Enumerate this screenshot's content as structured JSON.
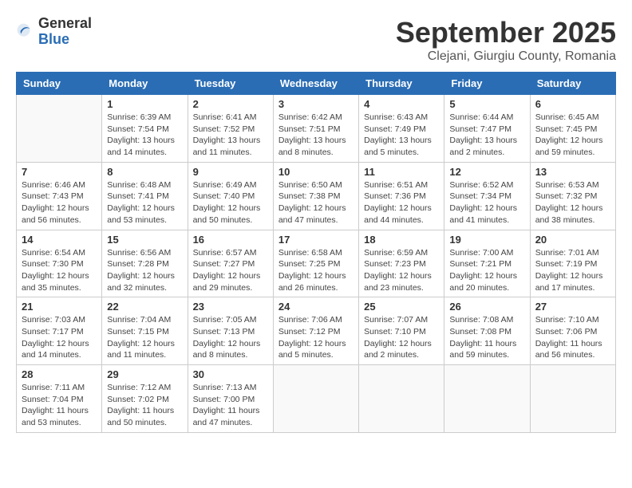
{
  "logo": {
    "general": "General",
    "blue": "Blue"
  },
  "title": "September 2025",
  "subtitle": "Clejani, Giurgiu County, Romania",
  "days_of_week": [
    "Sunday",
    "Monday",
    "Tuesday",
    "Wednesday",
    "Thursday",
    "Friday",
    "Saturday"
  ],
  "weeks": [
    [
      {
        "day": "",
        "info": ""
      },
      {
        "day": "1",
        "info": "Sunrise: 6:39 AM\nSunset: 7:54 PM\nDaylight: 13 hours\nand 14 minutes."
      },
      {
        "day": "2",
        "info": "Sunrise: 6:41 AM\nSunset: 7:52 PM\nDaylight: 13 hours\nand 11 minutes."
      },
      {
        "day": "3",
        "info": "Sunrise: 6:42 AM\nSunset: 7:51 PM\nDaylight: 13 hours\nand 8 minutes."
      },
      {
        "day": "4",
        "info": "Sunrise: 6:43 AM\nSunset: 7:49 PM\nDaylight: 13 hours\nand 5 minutes."
      },
      {
        "day": "5",
        "info": "Sunrise: 6:44 AM\nSunset: 7:47 PM\nDaylight: 13 hours\nand 2 minutes."
      },
      {
        "day": "6",
        "info": "Sunrise: 6:45 AM\nSunset: 7:45 PM\nDaylight: 12 hours\nand 59 minutes."
      }
    ],
    [
      {
        "day": "7",
        "info": "Sunrise: 6:46 AM\nSunset: 7:43 PM\nDaylight: 12 hours\nand 56 minutes."
      },
      {
        "day": "8",
        "info": "Sunrise: 6:48 AM\nSunset: 7:41 PM\nDaylight: 12 hours\nand 53 minutes."
      },
      {
        "day": "9",
        "info": "Sunrise: 6:49 AM\nSunset: 7:40 PM\nDaylight: 12 hours\nand 50 minutes."
      },
      {
        "day": "10",
        "info": "Sunrise: 6:50 AM\nSunset: 7:38 PM\nDaylight: 12 hours\nand 47 minutes."
      },
      {
        "day": "11",
        "info": "Sunrise: 6:51 AM\nSunset: 7:36 PM\nDaylight: 12 hours\nand 44 minutes."
      },
      {
        "day": "12",
        "info": "Sunrise: 6:52 AM\nSunset: 7:34 PM\nDaylight: 12 hours\nand 41 minutes."
      },
      {
        "day": "13",
        "info": "Sunrise: 6:53 AM\nSunset: 7:32 PM\nDaylight: 12 hours\nand 38 minutes."
      }
    ],
    [
      {
        "day": "14",
        "info": "Sunrise: 6:54 AM\nSunset: 7:30 PM\nDaylight: 12 hours\nand 35 minutes."
      },
      {
        "day": "15",
        "info": "Sunrise: 6:56 AM\nSunset: 7:28 PM\nDaylight: 12 hours\nand 32 minutes."
      },
      {
        "day": "16",
        "info": "Sunrise: 6:57 AM\nSunset: 7:27 PM\nDaylight: 12 hours\nand 29 minutes."
      },
      {
        "day": "17",
        "info": "Sunrise: 6:58 AM\nSunset: 7:25 PM\nDaylight: 12 hours\nand 26 minutes."
      },
      {
        "day": "18",
        "info": "Sunrise: 6:59 AM\nSunset: 7:23 PM\nDaylight: 12 hours\nand 23 minutes."
      },
      {
        "day": "19",
        "info": "Sunrise: 7:00 AM\nSunset: 7:21 PM\nDaylight: 12 hours\nand 20 minutes."
      },
      {
        "day": "20",
        "info": "Sunrise: 7:01 AM\nSunset: 7:19 PM\nDaylight: 12 hours\nand 17 minutes."
      }
    ],
    [
      {
        "day": "21",
        "info": "Sunrise: 7:03 AM\nSunset: 7:17 PM\nDaylight: 12 hours\nand 14 minutes."
      },
      {
        "day": "22",
        "info": "Sunrise: 7:04 AM\nSunset: 7:15 PM\nDaylight: 12 hours\nand 11 minutes."
      },
      {
        "day": "23",
        "info": "Sunrise: 7:05 AM\nSunset: 7:13 PM\nDaylight: 12 hours\nand 8 minutes."
      },
      {
        "day": "24",
        "info": "Sunrise: 7:06 AM\nSunset: 7:12 PM\nDaylight: 12 hours\nand 5 minutes."
      },
      {
        "day": "25",
        "info": "Sunrise: 7:07 AM\nSunset: 7:10 PM\nDaylight: 12 hours\nand 2 minutes."
      },
      {
        "day": "26",
        "info": "Sunrise: 7:08 AM\nSunset: 7:08 PM\nDaylight: 11 hours\nand 59 minutes."
      },
      {
        "day": "27",
        "info": "Sunrise: 7:10 AM\nSunset: 7:06 PM\nDaylight: 11 hours\nand 56 minutes."
      }
    ],
    [
      {
        "day": "28",
        "info": "Sunrise: 7:11 AM\nSunset: 7:04 PM\nDaylight: 11 hours\nand 53 minutes."
      },
      {
        "day": "29",
        "info": "Sunrise: 7:12 AM\nSunset: 7:02 PM\nDaylight: 11 hours\nand 50 minutes."
      },
      {
        "day": "30",
        "info": "Sunrise: 7:13 AM\nSunset: 7:00 PM\nDaylight: 11 hours\nand 47 minutes."
      },
      {
        "day": "",
        "info": ""
      },
      {
        "day": "",
        "info": ""
      },
      {
        "day": "",
        "info": ""
      },
      {
        "day": "",
        "info": ""
      }
    ]
  ]
}
